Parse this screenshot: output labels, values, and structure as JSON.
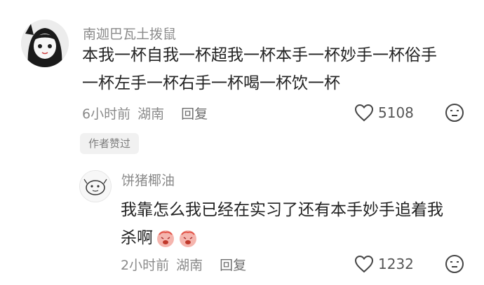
{
  "comments": [
    {
      "username": "南迦巴瓦土拨鼠",
      "text_line1": "本我一杯自我一杯超我一杯本手一杯妙手一杯俗手",
      "text_line2": "一杯左手一杯右手一杯喝一杯饮一杯",
      "time": "6小时前",
      "location": "湖南",
      "reply_label": "回复",
      "likes": "5108",
      "badge": "作者赞过"
    },
    {
      "username": "饼猪椰油",
      "text_line1": "我靠怎么我已经在实习了还有本手妙手追着我",
      "text_line2": "杀啊",
      "time": "2小时前",
      "location": "湖南",
      "reply_label": "回复",
      "likes": "1232"
    }
  ],
  "colors": {
    "meta": "#8a8a8a",
    "text": "#222222",
    "badge_bg": "#f1f1f1",
    "emoji": "#f28b82"
  },
  "icons": {
    "heart": "heart-outline-icon",
    "dislike": "neutral-face-icon",
    "emoji": "crying-face-emoji"
  }
}
